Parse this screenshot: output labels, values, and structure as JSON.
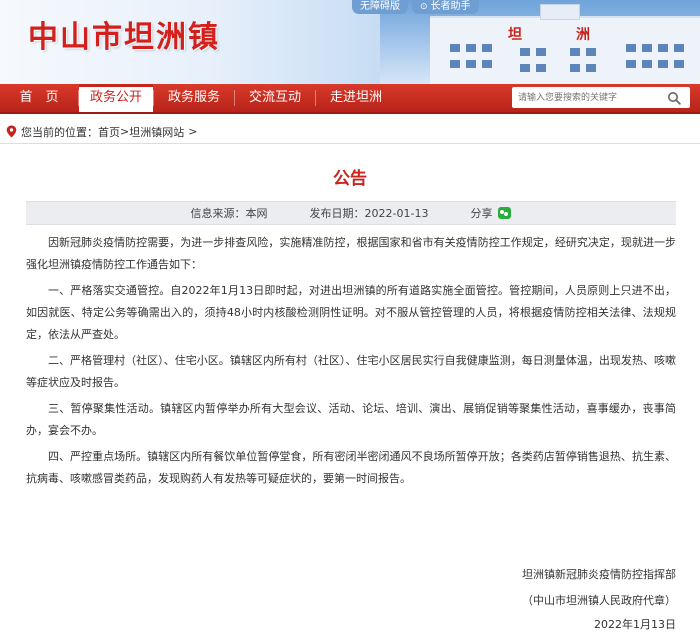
{
  "header": {
    "site_title": "中山市坦洲镇",
    "top_links": [
      {
        "label": "无障碍版",
        "icon": ""
      },
      {
        "label": "长者助手",
        "icon": "elder-icon"
      }
    ],
    "banner_building_chars": [
      "坦",
      "洲"
    ]
  },
  "nav": {
    "items": [
      {
        "label": "首　页",
        "active": false
      },
      {
        "label": "政务公开",
        "active": true
      },
      {
        "label": "政务服务",
        "active": false
      },
      {
        "label": "交流互动",
        "active": false
      },
      {
        "label": "走进坦洲",
        "active": false
      }
    ],
    "search": {
      "placeholder": "请输入您要搜索的关键字",
      "icon": "search-icon"
    }
  },
  "breadcrumb": {
    "prefix": "您当前的位置：",
    "home": "首页",
    "sep1": ">",
    "site": "坦洲镇网站",
    "sep2": ">"
  },
  "article": {
    "title": "公告",
    "source": "信息来源：本网",
    "date": "发布日期：2022-01-13",
    "share_label": "分享",
    "paragraphs": [
      "因新冠肺炎疫情防控需要，为进一步排查风险，实施精准防控，根据国家和省市有关疫情防控工作规定，经研究决定，现就进一步强化坦洲镇疫情防控工作通告如下：",
      "一、严格落实交通管控。自2022年1月13日即时起，对进出坦洲镇的所有道路实施全面管控。管控期间，人员原则上只进不出，如因就医、特定公务等确需出入的，须持48小时内核酸检测阴性证明。对不服从管控管理的人员，将根据疫情防控相关法律、法规规定，依法从严查处。",
      "二、严格管理村（社区）、住宅小区。镇辖区内所有村（社区）、住宅小区居民实行自我健康监测，每日测量体温，出现发热、咳嗽等症状应及时报告。",
      "三、暂停聚集性活动。镇辖区内暂停举办所有大型会议、活动、论坛、培训、演出、展销促销等聚集性活动，喜事缓办，丧事简办，宴会不办。",
      "四、严控重点场所。镇辖区内所有餐饮单位暂停堂食，所有密闭半密闭通风不良场所暂停开放；各类药店暂停销售退热、抗生素、抗病毒、咳嗽感冒类药品，发现购药人有发热等可疑症状的，要第一时间报告。"
    ],
    "signature": {
      "org": "坦洲镇新冠肺炎疫情防控指挥部",
      "gov": "（中山市坦洲镇人民政府代章）",
      "date": "2022年1月13日"
    }
  },
  "colors": {
    "brand_red": "#c8241e",
    "nav_red": "#c8241e",
    "meta_bg": "#ebedf0"
  }
}
